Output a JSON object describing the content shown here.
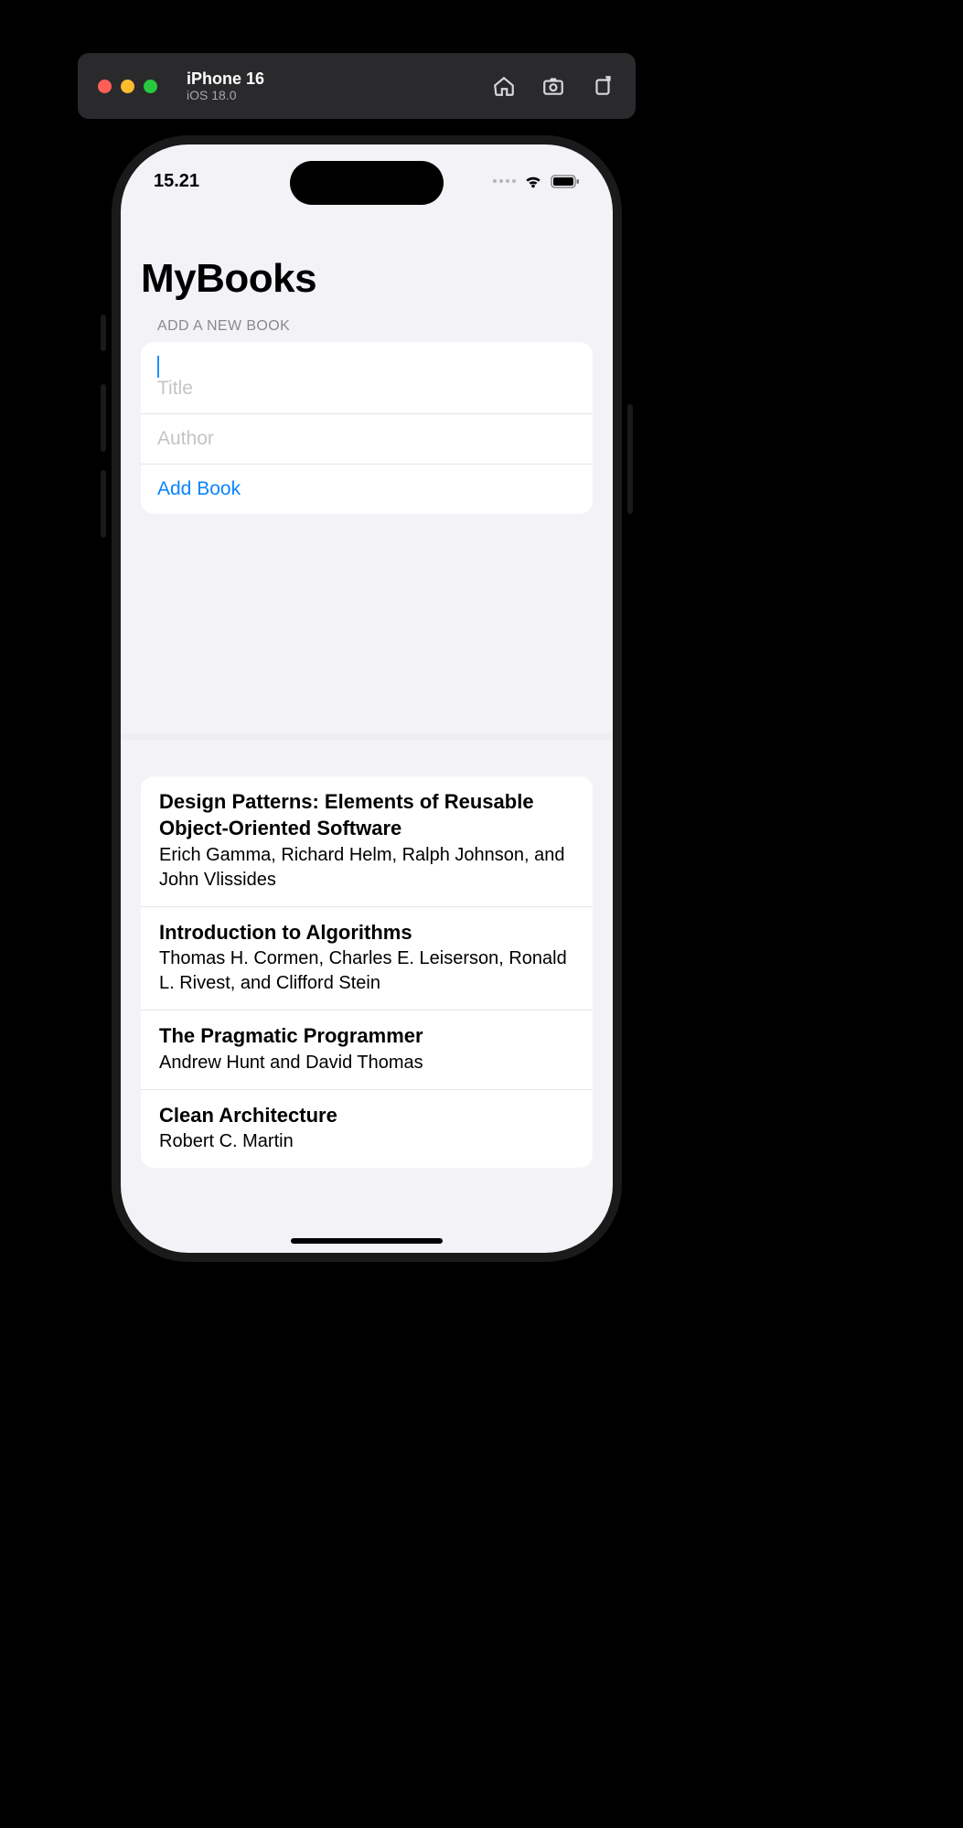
{
  "simulator": {
    "device": "iPhone 16",
    "os": "iOS 18.0",
    "icons": [
      "home-icon",
      "screenshot-icon",
      "rotate-icon"
    ]
  },
  "status": {
    "time": "15.21"
  },
  "page": {
    "title": "MyBooks"
  },
  "form": {
    "section_label": "ADD A NEW BOOK",
    "title_placeholder": "Title",
    "title_value": "",
    "author_placeholder": "Author",
    "author_value": "",
    "add_label": "Add Book"
  },
  "books": [
    {
      "title": "Design Patterns: Elements of Reusable Object-Oriented Software",
      "author": "Erich Gamma, Richard Helm, Ralph Johnson, and John Vlissides"
    },
    {
      "title": "Introduction to Algorithms",
      "author": "Thomas H. Cormen, Charles E. Leiserson, Ronald L. Rivest, and Clifford Stein"
    },
    {
      "title": "The Pragmatic Programmer",
      "author": "Andrew Hunt and David Thomas"
    },
    {
      "title": "Clean Architecture",
      "author": "Robert C. Martin"
    }
  ],
  "colors": {
    "accent": "#0a84ff",
    "bg": "#f2f2f7",
    "cursor": "#1f8fff"
  }
}
